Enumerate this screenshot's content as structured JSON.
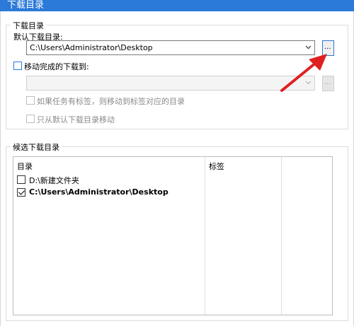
{
  "window": {
    "title": "下载目录"
  },
  "download_group": {
    "title": "下载目录",
    "default_dir_label": "默认下载目录:",
    "default_dir_value": "C:\\Users\\Administrator\\Desktop",
    "browse_label": "...",
    "move_completed_label": "移动完成的下载到:",
    "move_target_value": "",
    "move_by_tag_label": "如果任务有标签，则移动到标签对应的目录",
    "move_only_default_label": "只从默认下载目录移动"
  },
  "candidates_group": {
    "title": "候选下载目录",
    "columns": [
      "目录",
      "标签"
    ],
    "rows": [
      {
        "path": "D:\\新建文件夹",
        "checked": false,
        "bold": false
      },
      {
        "path": "C:\\Users\\Administrator\\Desktop",
        "checked": true,
        "bold": true
      }
    ]
  },
  "colors": {
    "accent": "#2b79d8",
    "arrow": "#e02020"
  }
}
